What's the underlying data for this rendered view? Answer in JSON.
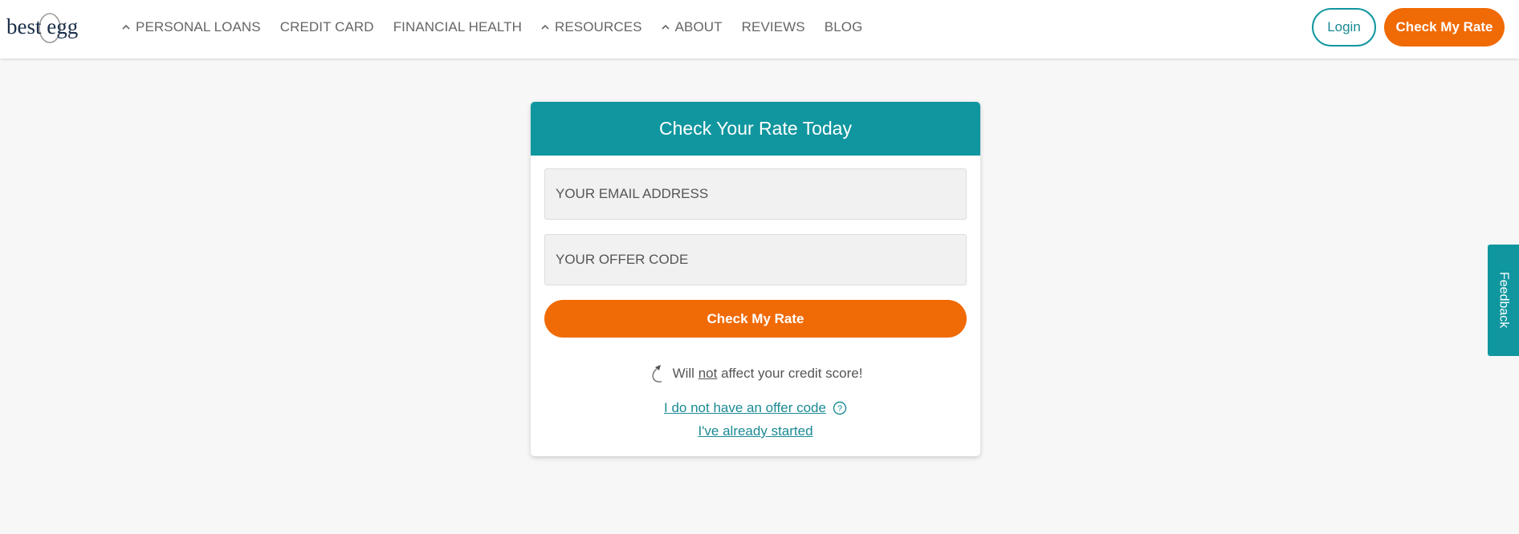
{
  "brand": {
    "logo_text": "best egg",
    "accent": "#10969f",
    "cta_color": "#f06a05"
  },
  "nav": {
    "items": [
      {
        "label": "PERSONAL LOANS",
        "icon": "chevron-up-icon",
        "has_chevron": true
      },
      {
        "label": "CREDIT CARD",
        "has_chevron": false
      },
      {
        "label": "FINANCIAL HEALTH",
        "has_chevron": false
      },
      {
        "label": "RESOURCES",
        "icon": "chevron-up-icon",
        "has_chevron": true
      },
      {
        "label": "ABOUT",
        "icon": "chevron-up-icon",
        "has_chevron": true
      },
      {
        "label": "REVIEWS",
        "has_chevron": false
      },
      {
        "label": "BLOG",
        "has_chevron": false
      }
    ],
    "login_label": "Login",
    "cta_label": "Check My Rate"
  },
  "card": {
    "title": "Check Your Rate Today",
    "email_placeholder": "YOUR EMAIL ADDRESS",
    "email_value": "",
    "offer_placeholder": "YOUR OFFER CODE",
    "offer_value": "",
    "submit_label": "Check My Rate",
    "note_prefix": "Will ",
    "note_emphasis": "not",
    "note_suffix": " affect your credit score!",
    "no_offer_link": "I do not have an offer code",
    "help_icon": "question-circle-icon",
    "started_link": "I've already started"
  },
  "feedback": {
    "label": "Feedback"
  }
}
